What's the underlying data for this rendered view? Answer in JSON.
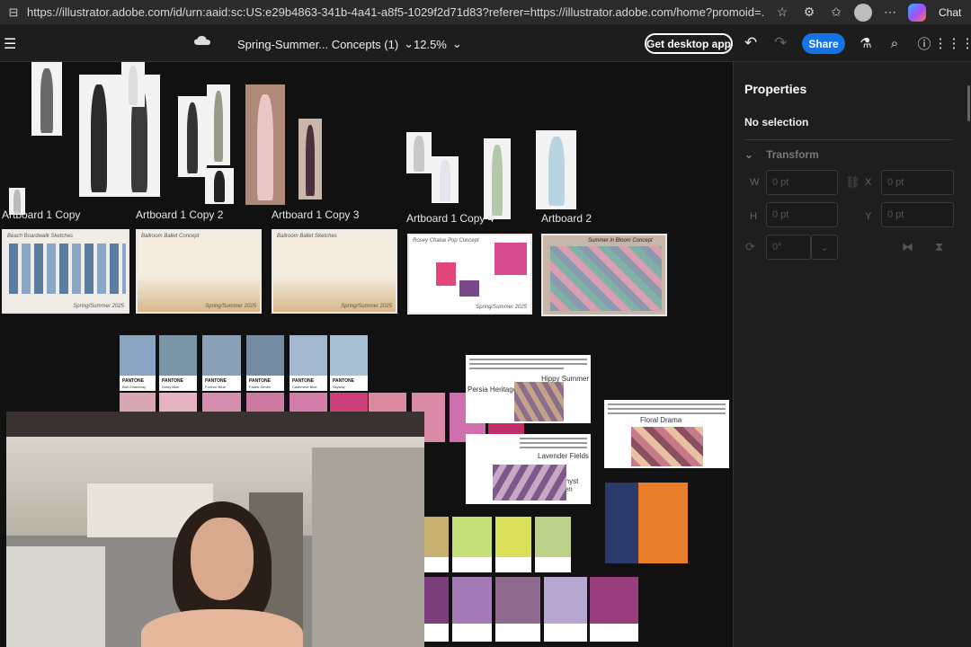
{
  "browser": {
    "url": "https://illustrator.adobe.com/id/urn:aaid:sc:US:e29b4863-341b-4a41-a8f5-1029f2d71d83?referer=https://illustrator.adobe.com/home?promoid=...",
    "chat_label": "Chat"
  },
  "toolbar": {
    "doc_title": "Spring-Summer... Concepts (1)",
    "zoom": "12.5%",
    "desktop_label": "Get desktop app",
    "share_label": "Share"
  },
  "artboards": {
    "a1copy": "Artboard 1 Copy",
    "a1copy2": "Artboard 1 Copy 2",
    "a1copy3": "Artboard 1 Copy 3",
    "a1copy4": "Artboard 1 Copy 4",
    "a2": "Artboard 2"
  },
  "boards": {
    "b1": "Beach Boardwalk Sketches",
    "b2": "Ballroom Ballet Concept",
    "b3": "Ballroom Ballet Sketches",
    "b4": "Rosey Chaise Pop Concept",
    "b5": "Summer in Bloom Concept",
    "sig": "Spring/Summer 2025"
  },
  "pantone_blue": [
    {
      "pt": "PANTONE",
      "name": "Ball Chambray",
      "color": "#8aa5c3"
    },
    {
      "pt": "PANTONE",
      "name": "Dusty Blue",
      "color": "#7b95a8"
    },
    {
      "pt": "PANTONE",
      "name": "Forever Blue",
      "color": "#8aa0b8"
    },
    {
      "pt": "PANTONE",
      "name": "Faded Denim",
      "color": "#738ba3"
    },
    {
      "pt": "PANTONE",
      "name": "Cashmere Blue",
      "color": "#a3b8cf"
    },
    {
      "pt": "PANTONE",
      "name": "Skyway",
      "color": "#a9bfd4"
    }
  ],
  "docs": {
    "persia": "Persia Heritage",
    "hippy": "Hippy Summer",
    "lavender": "Lavender Fields",
    "amethyst": "Amethyst Garden",
    "floral": "Floral Drama"
  },
  "panel": {
    "title": "Properties",
    "no_selection": "No selection",
    "transform": "Transform",
    "w": "W",
    "h": "H",
    "x": "X",
    "y": "Y",
    "w_val": "0 pt",
    "h_val": "0 pt",
    "x_val": "0 pt",
    "y_val": "0 pt",
    "rot_val": "0°"
  }
}
